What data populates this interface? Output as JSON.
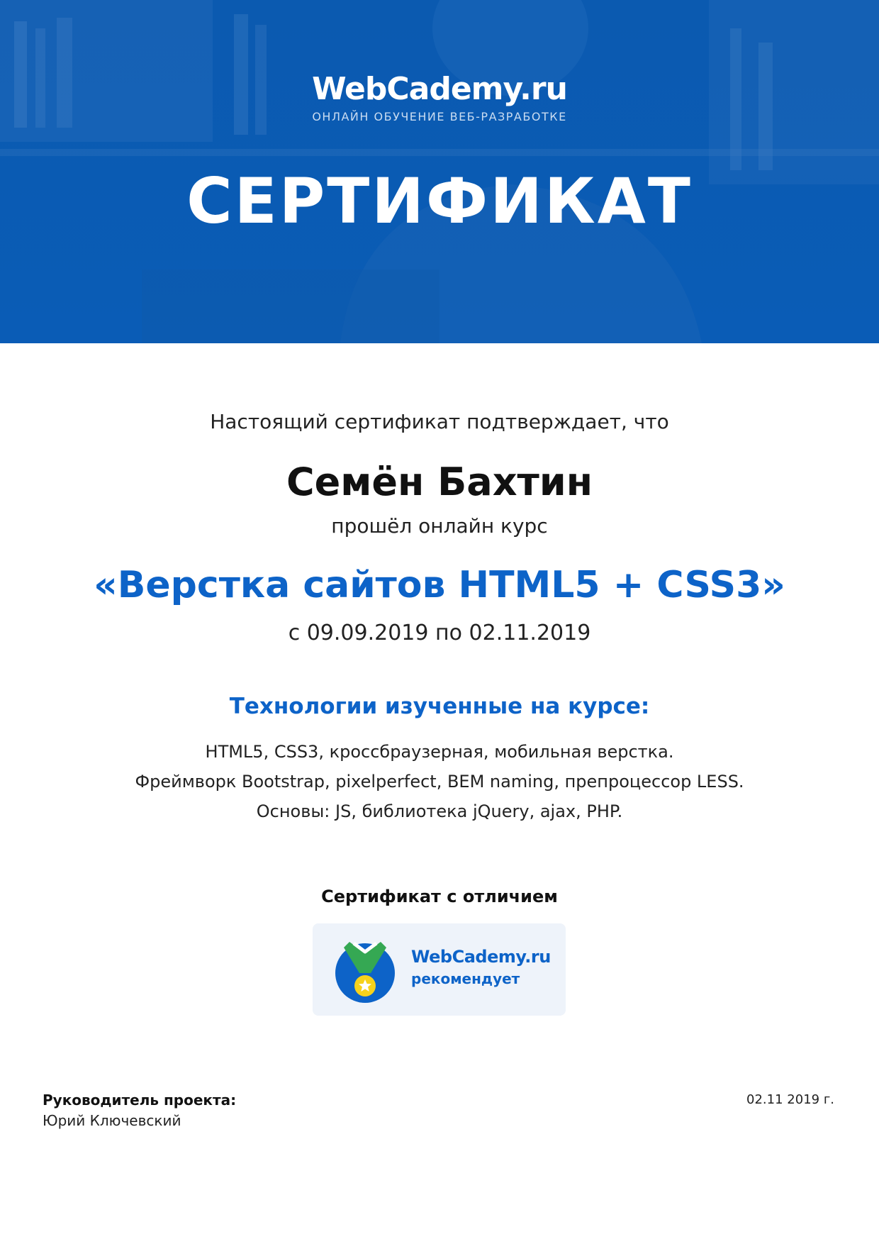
{
  "header": {
    "brand": "WebCademy.ru",
    "tagline": "ОНЛАЙН ОБУЧЕНИЕ ВЕБ-РАЗРАБОТКЕ",
    "title": "СЕРТИФИКАТ"
  },
  "body": {
    "confirm_text": "Настоящий сертификат подтверждает, что",
    "recipient_name": "Семён Бахтин",
    "passed_text": "прошёл онлайн курс",
    "course_name": "«Верстка сайтов HTML5 + CSS3»",
    "dates": "с 09.09.2019 по 02.11.2019",
    "technologies_heading": "Технологии изученные на курсе:",
    "technologies": [
      "HTML5, CSS3, кроссбраузерная, мобильная верстка.",
      "Фреймворк Bootstrap, pixelperfect, BEM naming, препроцессор LESS.",
      "Основы: JS, библиотека jQuery, ajax, PHP."
    ],
    "distinction": "Сертификат с отличием"
  },
  "badge": {
    "brand": "WebCademy.ru",
    "recommends": "рекомендует",
    "icon": "medal-icon"
  },
  "footer": {
    "label": "Руководитель проекта:",
    "person": "Юрий Ключевский",
    "date": "02.11 2019 г."
  },
  "colors": {
    "header_blue": "#0b5fb5",
    "accent_blue": "#0d63c8",
    "medal_green": "#35a853",
    "medal_yellow": "#f7d21b",
    "badge_bg": "#eef3fa"
  }
}
